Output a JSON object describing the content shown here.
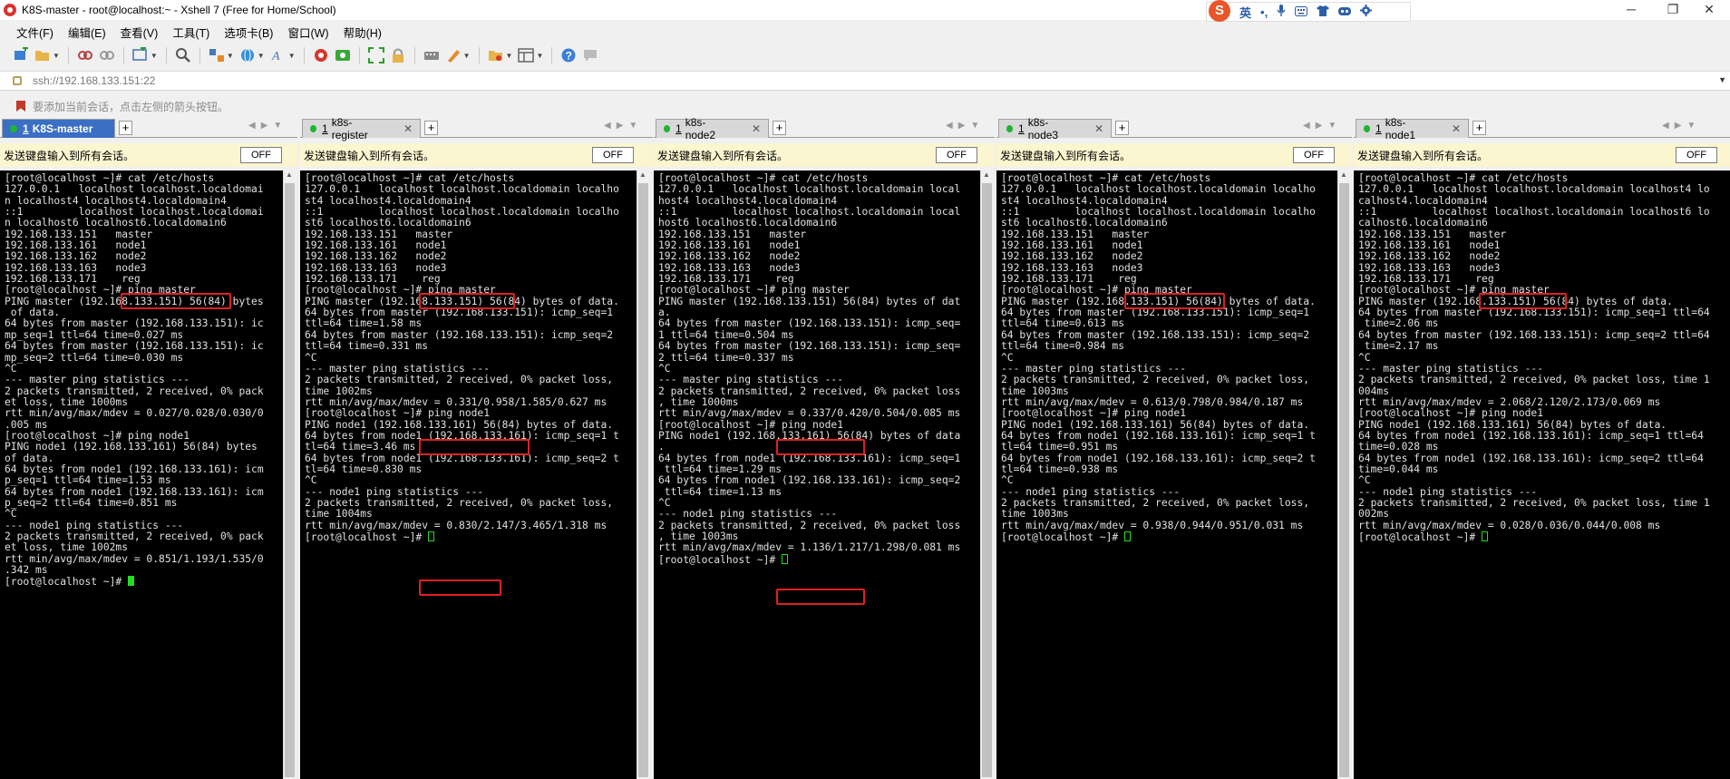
{
  "window": {
    "title": "K8S-master - root@localhost:~ - Xshell 7 (Free for Home/School)",
    "minimize": "─",
    "maximize": "❐",
    "close": "✕"
  },
  "ime": {
    "logo": "S",
    "mode": "英",
    "items": [
      "•,",
      "🎤",
      "⌨",
      "👕",
      "⊞",
      "☸",
      "⚙"
    ]
  },
  "menu": [
    "文件(F)",
    "编辑(E)",
    "查看(V)",
    "工具(T)",
    "选项卡(B)",
    "窗口(W)",
    "帮助(H)"
  ],
  "address": "ssh://192.168.133.151:22",
  "hint": "要添加当前会话，点击左侧的箭头按钮。",
  "send_bar": {
    "label": "发送键盘输入到所有会话。",
    "off_label": "OFF"
  },
  "panes": [
    {
      "tab_num": "1",
      "tab_name": "K8S-master",
      "active": true,
      "lines": [
        "[root@localhost ~]# cat /etc/hosts",
        "127.0.0.1   localhost localhost.localdomai",
        "n localhost4 localhost4.localdomain4",
        "::1         localhost localhost.localdomai",
        "n localhost6 localhost6.localdomain6",
        "192.168.133.151   master",
        "192.168.133.161   node1",
        "192.168.133.162   node2",
        "192.168.133.163   node3",
        "192.168.133.171    reg",
        "[root@localhost ~]# ping master",
        "PING master (192.168.133.151) 56(84) bytes",
        " of data.",
        "64 bytes from master (192.168.133.151): ic",
        "mp_seq=1 ttl=64 time=0.027 ms",
        "64 bytes from master (192.168.133.151): ic",
        "mp_seq=2 ttl=64 time=0.030 ms",
        "^C",
        "--- master ping statistics ---",
        "2 packets transmitted, 2 received, 0% pack",
        "et loss, time 1000ms",
        "rtt min/avg/max/mdev = 0.027/0.028/0.030/0",
        ".005 ms",
        "[root@localhost ~]# ping node1",
        "PING node1 (192.168.133.161) 56(84) bytes",
        "of data.",
        "64 bytes from node1 (192.168.133.161): icm",
        "p_seq=1 ttl=64 time=1.53 ms",
        "64 bytes from node1 (192.168.133.161): icm",
        "p_seq=2 ttl=64 time=0.851 ms",
        "^C",
        "--- node1 ping statistics ---",
        "2 packets transmitted, 2 received, 0% pack",
        "et loss, time 1002ms",
        "rtt min/avg/max/mdev = 0.851/1.193/1.535/0",
        ".342 ms",
        "[root@localhost ~]# "
      ]
    },
    {
      "tab_num": "1",
      "tab_name": "k8s-register",
      "active": false,
      "lines": [
        "[root@localhost ~]# cat /etc/hosts",
        "127.0.0.1   localhost localhost.localdomain localho",
        "st4 localhost4.localdomain4",
        "::1         localhost localhost.localdomain localho",
        "st6 localhost6.localdomain6",
        "192.168.133.151   master",
        "192.168.133.161   node1",
        "192.168.133.162   node2",
        "192.168.133.163   node3",
        "192.168.133.171    reg",
        "[root@localhost ~]# ping master",
        "PING master (192.168.133.151) 56(84) bytes of data.",
        "64 bytes from master (192.168.133.151): icmp_seq=1",
        "ttl=64 time=1.58 ms",
        "64 bytes from master (192.168.133.151): icmp_seq=2",
        "ttl=64 time=0.331 ms",
        "^C",
        "--- master ping statistics ---",
        "2 packets transmitted, 2 received, 0% packet loss,",
        "time 1002ms",
        "rtt min/avg/max/mdev = 0.331/0.958/1.585/0.627 ms",
        "[root@localhost ~]# ping node1",
        "PING node1 (192.168.133.161) 56(84) bytes of data.",
        "64 bytes from node1 (192.168.133.161): icmp_seq=1 t",
        "tl=64 time=3.46 ms",
        "64 bytes from node1 (192.168.133.161): icmp_seq=2 t",
        "tl=64 time=0.830 ms",
        "^C",
        "--- node1 ping statistics ---",
        "2 packets transmitted, 2 received, 0% packet loss,",
        "time 1004ms",
        "rtt min/avg/max/mdev = 0.830/2.147/3.465/1.318 ms",
        "[root@localhost ~]# "
      ]
    },
    {
      "tab_num": "1",
      "tab_name": "k8s-node2",
      "active": false,
      "lines": [
        "[root@localhost ~]# cat /etc/hosts",
        "127.0.0.1   localhost localhost.localdomain local",
        "host4 localhost4.localdomain4",
        "::1         localhost localhost.localdomain local",
        "host6 localhost6.localdomain6",
        "192.168.133.151   master",
        "192.168.133.161   node1",
        "192.168.133.162   node2",
        "192.168.133.163   node3",
        "192.168.133.171    reg",
        "[root@localhost ~]# ping master",
        "PING master (192.168.133.151) 56(84) bytes of dat",
        "a.",
        "64 bytes from master (192.168.133.151): icmp_seq=",
        "1 ttl=64 time=0.504 ms",
        "64 bytes from master (192.168.133.151): icmp_seq=",
        "2 ttl=64 time=0.337 ms",
        "^C",
        "--- master ping statistics ---",
        "2 packets transmitted, 2 received, 0% packet loss",
        ", time 1000ms",
        "rtt min/avg/max/mdev = 0.337/0.420/0.504/0.085 ms",
        "[root@localhost ~]# ping node1",
        "PING node1 (192.168.133.161) 56(84) bytes of data",
        ".",
        "64 bytes from node1 (192.168.133.161): icmp_seq=1",
        " ttl=64 time=1.29 ms",
        "64 bytes from node1 (192.168.133.161): icmp_seq=2",
        " ttl=64 time=1.13 ms",
        "^C",
        "--- node1 ping statistics ---",
        "2 packets transmitted, 2 received, 0% packet loss",
        ", time 1003ms",
        "rtt min/avg/max/mdev = 1.136/1.217/1.298/0.081 ms",
        "[root@localhost ~]# "
      ]
    },
    {
      "tab_num": "1",
      "tab_name": "k8s-node3",
      "active": false,
      "lines": [
        "[root@localhost ~]# cat /etc/hosts",
        "127.0.0.1   localhost localhost.localdomain localho",
        "st4 localhost4.localdomain4",
        "::1         localhost localhost.localdomain localho",
        "st6 localhost6.localdomain6",
        "192.168.133.151   master",
        "192.168.133.161   node1",
        "192.168.133.162   node2",
        "192.168.133.163   node3",
        "192.168.133.171    reg",
        "[root@localhost ~]# ping master",
        "PING master (192.168.133.151) 56(84) bytes of data.",
        "64 bytes from master (192.168.133.151): icmp_seq=1",
        "ttl=64 time=0.613 ms",
        "64 bytes from master (192.168.133.151): icmp_seq=2",
        "ttl=64 time=0.984 ms",
        "^C",
        "--- master ping statistics ---",
        "2 packets transmitted, 2 received, 0% packet loss,",
        "time 1003ms",
        "rtt min/avg/max/mdev = 0.613/0.798/0.984/0.187 ms",
        "[root@localhost ~]# ping node1",
        "PING node1 (192.168.133.161) 56(84) bytes of data.",
        "64 bytes from node1 (192.168.133.161): icmp_seq=1 t",
        "tl=64 time=0.951 ms",
        "64 bytes from node1 (192.168.133.161): icmp_seq=2 t",
        "tl=64 time=0.938 ms",
        "^C",
        "--- node1 ping statistics ---",
        "2 packets transmitted, 2 received, 0% packet loss,",
        "time 1003ms",
        "rtt min/avg/max/mdev = 0.938/0.944/0.951/0.031 ms",
        "[root@localhost ~]# "
      ]
    },
    {
      "tab_num": "1",
      "tab_name": "k8s-node1",
      "active": false,
      "lines": [
        "[root@localhost ~]# cat /etc/hosts",
        "127.0.0.1   localhost localhost.localdomain localhost4 lo",
        "calhost4.localdomain4",
        "::1         localhost localhost.localdomain localhost6 lo",
        "calhost6.localdomain6",
        "192.168.133.151   master",
        "192.168.133.161   node1",
        "192.168.133.162   node2",
        "192.168.133.163   node3",
        "192.168.133.171    reg",
        "[root@localhost ~]# ping master",
        "PING master (192.168.133.151) 56(84) bytes of data.",
        "64 bytes from master (192.168.133.151): icmp_seq=1 ttl=64",
        " time=2.06 ms",
        "64 bytes from master (192.168.133.151): icmp_seq=2 ttl=64",
        " time=2.17 ms",
        "^C",
        "--- master ping statistics ---",
        "2 packets transmitted, 2 received, 0% packet loss, time 1",
        "004ms",
        "rtt min/avg/max/mdev = 2.068/2.120/2.173/0.069 ms",
        "[root@localhost ~]# ping node1",
        "PING node1 (192.168.133.161) 56(84) bytes of data.",
        "64 bytes from node1 (192.168.133.161): icmp_seq=1 ttl=64",
        "time=0.028 ms",
        "64 bytes from node1 (192.168.133.161): icmp_seq=2 ttl=64",
        "time=0.044 ms",
        "^C",
        "--- node1 ping statistics ---",
        "2 packets transmitted, 2 received, 0% packet loss, time 1",
        "002ms",
        "rtt min/avg/max/mdev = 0.028/0.036/0.044/0.008 ms",
        "[root@localhost ~]# "
      ]
    }
  ],
  "colors": {
    "active_tab": "#3a6fc4",
    "session_dot": "#1fb332",
    "highlight_box": "#e02020",
    "cursor": "#22dd22",
    "send_bar_bg": "#fbf5d0"
  }
}
